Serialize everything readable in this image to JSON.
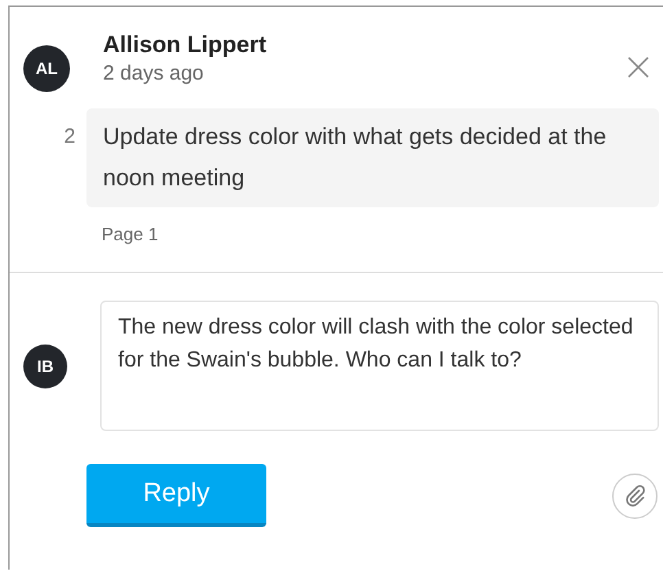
{
  "comment": {
    "avatar": "AL",
    "author": "Allison Lippert",
    "time": "2 days ago",
    "number": "2",
    "text": "Update dress color with what gets decided at the noon meeting",
    "page": "Page 1"
  },
  "reply": {
    "avatar": "IB",
    "value": "The new dress color will clash with the color selected for the Swain's bubble. Who can I talk to?",
    "button": "Reply"
  }
}
